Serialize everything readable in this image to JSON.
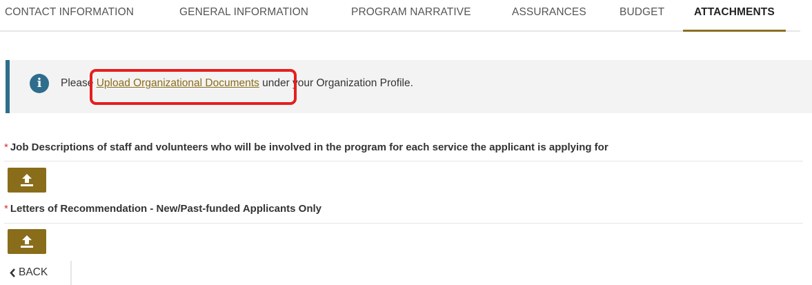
{
  "tabs": [
    {
      "label": "CONTACT INFORMATION",
      "active": false
    },
    {
      "label": "GENERAL INFORMATION",
      "active": false
    },
    {
      "label": "PROGRAM NARRATIVE",
      "active": false
    },
    {
      "label": "ASSURANCES",
      "active": false
    },
    {
      "label": "BUDGET",
      "active": false
    },
    {
      "label": "ATTACHMENTS",
      "active": true
    }
  ],
  "notice": {
    "icon": "info-icon",
    "icon_glyph": "i",
    "prefix": "Please ",
    "link_text": "Upload Organizational Documents",
    "suffix": " under your Organization Profile."
  },
  "attachments": [
    {
      "required_mark": "*",
      "label": "Job Descriptions of staff and volunteers who will be involved in the program for each service the applicant is applying for",
      "button_icon": "upload-icon"
    },
    {
      "required_mark": "*",
      "label": "Letters of Recommendation - New/Past-funded Applicants Only",
      "button_icon": "upload-icon"
    }
  ],
  "back": {
    "icon": "chevron-left-icon",
    "label": "BACK"
  },
  "colors": {
    "accent_gold": "#8a6d1a",
    "info_blue": "#2f6d8c",
    "required_red": "#d13030",
    "highlight_red": "#e61e1e"
  }
}
